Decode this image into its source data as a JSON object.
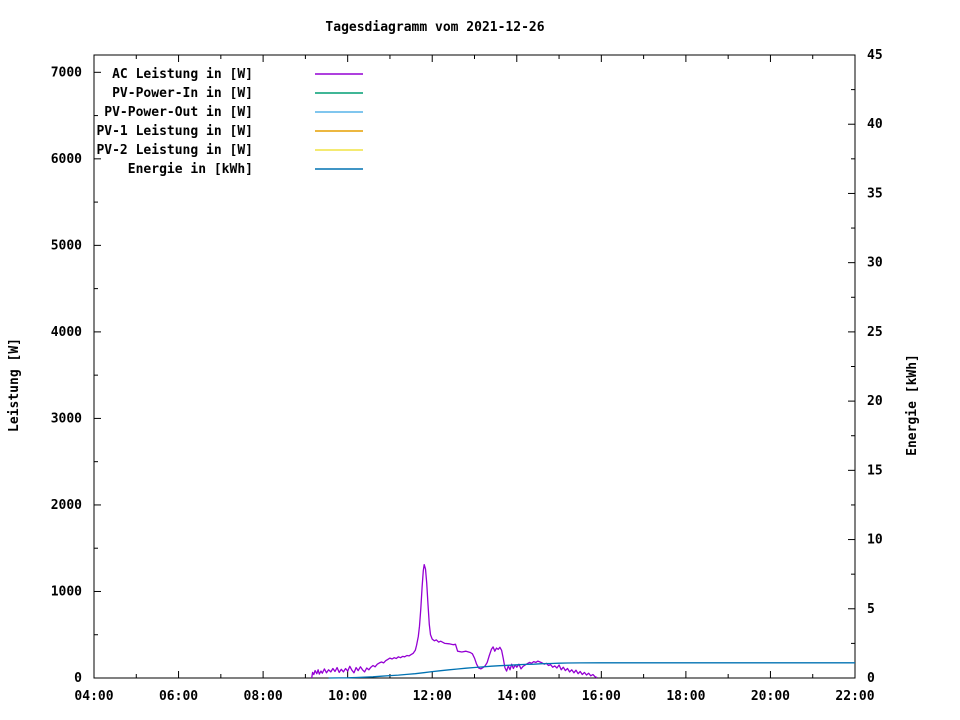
{
  "colors": {
    "background": "#ffffff",
    "foreground": "#000000",
    "ac": "#9400d3",
    "pv_in": "#009e73",
    "pv_out": "#56b4e9",
    "pv1": "#e69f00",
    "pv2": "#f0e442",
    "energy": "#0072b2"
  },
  "chart_data": {
    "type": "line",
    "title": "Tagesdiagramm vom 2021-12-26",
    "x_axis": {
      "range": [
        4,
        22
      ],
      "minor_step": 1,
      "ticks": [
        {
          "value": 4,
          "label": "04:00"
        },
        {
          "value": 6,
          "label": "06:00"
        },
        {
          "value": 8,
          "label": "08:00"
        },
        {
          "value": 10,
          "label": "10:00"
        },
        {
          "value": 12,
          "label": "12:00"
        },
        {
          "value": 14,
          "label": "14:00"
        },
        {
          "value": 16,
          "label": "16:00"
        },
        {
          "value": 18,
          "label": "18:00"
        },
        {
          "value": 20,
          "label": "20:00"
        },
        {
          "value": 22,
          "label": "22:00"
        }
      ]
    },
    "y_axis_left": {
      "title": "Leistung [W]",
      "range": [
        0,
        7200
      ],
      "ticks": [
        0,
        1000,
        2000,
        3000,
        4000,
        5000,
        6000,
        7000
      ],
      "minor_step": 500
    },
    "y_axis_right": {
      "title": "Energie [kWh]",
      "range": [
        0,
        45
      ],
      "ticks": [
        0,
        5,
        10,
        15,
        20,
        25,
        30,
        35,
        40,
        45
      ],
      "minor_step": 2.5
    },
    "legend_position": "top-left-inside",
    "grid": false,
    "series": [
      {
        "label": "AC Leistung in [W]",
        "color": "#9400d3",
        "axis": "left",
        "points": [
          [
            9.15,
            0
          ],
          [
            9.17,
            65
          ],
          [
            9.2,
            40
          ],
          [
            9.23,
            85
          ],
          [
            9.27,
            50
          ],
          [
            9.3,
            95
          ],
          [
            9.33,
            45
          ],
          [
            9.37,
            80
          ],
          [
            9.4,
            55
          ],
          [
            9.45,
            105
          ],
          [
            9.5,
            60
          ],
          [
            9.55,
            95
          ],
          [
            9.6,
            70
          ],
          [
            9.65,
            110
          ],
          [
            9.7,
            75
          ],
          [
            9.75,
            120
          ],
          [
            9.8,
            65
          ],
          [
            9.85,
            100
          ],
          [
            9.9,
            70
          ],
          [
            9.95,
            110
          ],
          [
            10.0,
            80
          ],
          [
            10.05,
            135
          ],
          [
            10.1,
            90
          ],
          [
            10.15,
            60
          ],
          [
            10.2,
            120
          ],
          [
            10.25,
            85
          ],
          [
            10.3,
            130
          ],
          [
            10.35,
            95
          ],
          [
            10.4,
            70
          ],
          [
            10.45,
            115
          ],
          [
            10.5,
            95
          ],
          [
            10.55,
            125
          ],
          [
            10.6,
            145
          ],
          [
            10.65,
            130
          ],
          [
            10.7,
            160
          ],
          [
            10.75,
            175
          ],
          [
            10.8,
            185
          ],
          [
            10.85,
            175
          ],
          [
            10.9,
            200
          ],
          [
            10.95,
            215
          ],
          [
            11.0,
            230
          ],
          [
            11.05,
            220
          ],
          [
            11.1,
            235
          ],
          [
            11.15,
            225
          ],
          [
            11.2,
            245
          ],
          [
            11.25,
            235
          ],
          [
            11.3,
            250
          ],
          [
            11.35,
            245
          ],
          [
            11.4,
            260
          ],
          [
            11.45,
            255
          ],
          [
            11.5,
            270
          ],
          [
            11.55,
            285
          ],
          [
            11.6,
            320
          ],
          [
            11.63,
            380
          ],
          [
            11.67,
            480
          ],
          [
            11.7,
            600
          ],
          [
            11.73,
            800
          ],
          [
            11.76,
            1050
          ],
          [
            11.79,
            1240
          ],
          [
            11.81,
            1310
          ],
          [
            11.84,
            1260
          ],
          [
            11.87,
            1100
          ],
          [
            11.9,
            850
          ],
          [
            11.93,
            620
          ],
          [
            11.96,
            500
          ],
          [
            12.0,
            450
          ],
          [
            12.05,
            430
          ],
          [
            12.1,
            440
          ],
          [
            12.15,
            415
          ],
          [
            12.2,
            425
          ],
          [
            12.3,
            400
          ],
          [
            12.4,
            395
          ],
          [
            12.5,
            385
          ],
          [
            12.55,
            390
          ],
          [
            12.6,
            310
          ],
          [
            12.7,
            300
          ],
          [
            12.8,
            310
          ],
          [
            12.9,
            295
          ],
          [
            12.95,
            280
          ],
          [
            13.0,
            230
          ],
          [
            13.05,
            160
          ],
          [
            13.1,
            115
          ],
          [
            13.15,
            105
          ],
          [
            13.2,
            120
          ],
          [
            13.25,
            140
          ],
          [
            13.3,
            180
          ],
          [
            13.35,
            260
          ],
          [
            13.4,
            330
          ],
          [
            13.44,
            360
          ],
          [
            13.48,
            310
          ],
          [
            13.52,
            345
          ],
          [
            13.56,
            330
          ],
          [
            13.6,
            355
          ],
          [
            13.64,
            320
          ],
          [
            13.68,
            230
          ],
          [
            13.72,
            120
          ],
          [
            13.76,
            80
          ],
          [
            13.8,
            140
          ],
          [
            13.84,
            95
          ],
          [
            13.88,
            160
          ],
          [
            13.92,
            110
          ],
          [
            13.96,
            150
          ],
          [
            14.0,
            125
          ],
          [
            14.05,
            160
          ],
          [
            14.1,
            105
          ],
          [
            14.15,
            135
          ],
          [
            14.2,
            150
          ],
          [
            14.25,
            165
          ],
          [
            14.3,
            180
          ],
          [
            14.35,
            170
          ],
          [
            14.4,
            190
          ],
          [
            14.45,
            180
          ],
          [
            14.5,
            195
          ],
          [
            14.55,
            185
          ],
          [
            14.6,
            175
          ],
          [
            14.65,
            160
          ],
          [
            14.7,
            170
          ],
          [
            14.75,
            145
          ],
          [
            14.8,
            155
          ],
          [
            14.85,
            125
          ],
          [
            14.9,
            140
          ],
          [
            14.95,
            115
          ],
          [
            15.0,
            150
          ],
          [
            15.05,
            95
          ],
          [
            15.1,
            125
          ],
          [
            15.15,
            85
          ],
          [
            15.2,
            110
          ],
          [
            15.25,
            70
          ],
          [
            15.3,
            95
          ],
          [
            15.35,
            60
          ],
          [
            15.4,
            90
          ],
          [
            15.45,
            50
          ],
          [
            15.5,
            75
          ],
          [
            15.55,
            40
          ],
          [
            15.6,
            65
          ],
          [
            15.65,
            35
          ],
          [
            15.7,
            55
          ],
          [
            15.75,
            25
          ],
          [
            15.8,
            40
          ],
          [
            15.85,
            15
          ],
          [
            15.9,
            5
          ]
        ]
      },
      {
        "label": "PV-Power-In in [W]",
        "color": "#009e73",
        "axis": "left",
        "points": []
      },
      {
        "label": "PV-Power-Out in [W]",
        "color": "#56b4e9",
        "axis": "left",
        "points": []
      },
      {
        "label": "PV-1 Leistung in [W]",
        "color": "#e69f00",
        "axis": "left",
        "points": []
      },
      {
        "label": "PV-2 Leistung in [W]",
        "color": "#f0e442",
        "axis": "left",
        "points": []
      },
      {
        "label": "Energie in [kWh]",
        "color": "#0072b2",
        "axis": "right",
        "points": [
          [
            9.55,
            0
          ],
          [
            9.8,
            0.005
          ],
          [
            10.0,
            0.015
          ],
          [
            10.2,
            0.035
          ],
          [
            10.4,
            0.06
          ],
          [
            10.6,
            0.09
          ],
          [
            10.8,
            0.13
          ],
          [
            11.0,
            0.17
          ],
          [
            11.2,
            0.21
          ],
          [
            11.4,
            0.26
          ],
          [
            11.6,
            0.31
          ],
          [
            11.8,
            0.38
          ],
          [
            12.0,
            0.46
          ],
          [
            12.2,
            0.53
          ],
          [
            12.4,
            0.59
          ],
          [
            12.6,
            0.65
          ],
          [
            12.8,
            0.71
          ],
          [
            13.0,
            0.76
          ],
          [
            13.2,
            0.8
          ],
          [
            13.4,
            0.85
          ],
          [
            13.6,
            0.89
          ],
          [
            13.8,
            0.92
          ],
          [
            14.0,
            0.95
          ],
          [
            14.2,
            0.98
          ],
          [
            14.4,
            1.0
          ],
          [
            14.6,
            1.03
          ],
          [
            14.8,
            1.05
          ],
          [
            15.0,
            1.07
          ],
          [
            15.2,
            1.08
          ],
          [
            15.5,
            1.09
          ],
          [
            16.0,
            1.1
          ],
          [
            22.0,
            1.1
          ]
        ]
      }
    ]
  }
}
